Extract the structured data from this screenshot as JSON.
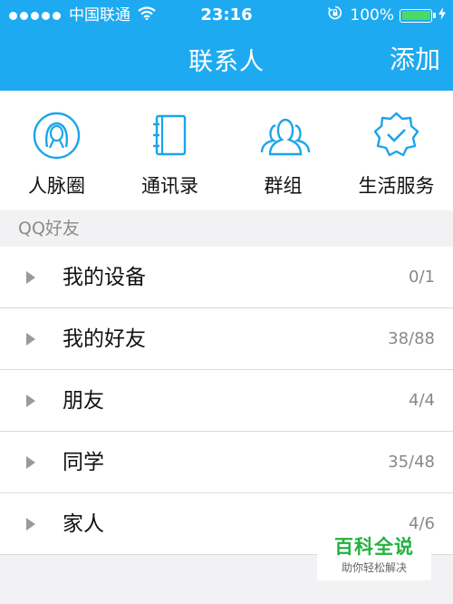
{
  "status_bar": {
    "carrier": "中国联通",
    "time": "23:16",
    "battery_percent": "100%",
    "battery_level": 1.0,
    "signal_bars": 5,
    "icons": [
      "signal-dots-icon",
      "wifi-icon",
      "orientation-lock-icon",
      "battery-icon",
      "charging-icon"
    ]
  },
  "nav": {
    "title": "联系人",
    "add_label": "添加"
  },
  "quick_actions": [
    {
      "label": "人脉圈",
      "icon": "contacts-circle-icon"
    },
    {
      "label": "通讯录",
      "icon": "address-book-icon"
    },
    {
      "label": "群组",
      "icon": "group-icon"
    },
    {
      "label": "生活服务",
      "icon": "life-service-badge-icon"
    }
  ],
  "section": {
    "title": "QQ好友"
  },
  "groups": [
    {
      "name": "我的设备",
      "count": "0/1"
    },
    {
      "name": "我的好友",
      "count": "38/88"
    },
    {
      "name": "朋友",
      "count": "4/4"
    },
    {
      "name": "同学",
      "count": "35/48"
    },
    {
      "name": "家人",
      "count": "4/6"
    }
  ],
  "watermark": {
    "title": "百科全说",
    "subtitle": "助你轻松解决"
  },
  "colors": {
    "header_blue": "#1eaaf1",
    "battery_green": "#4cd964",
    "watermark_green": "#23b23f"
  }
}
